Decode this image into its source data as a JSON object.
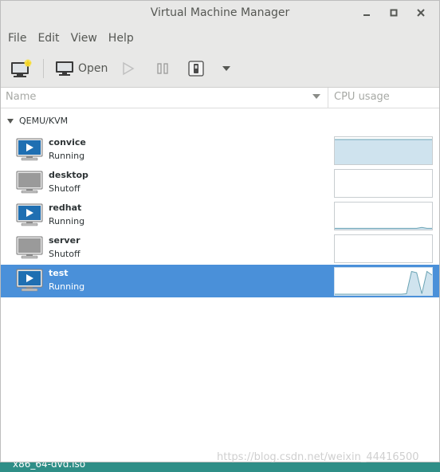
{
  "window": {
    "title": "Virtual Machine Manager",
    "controls": [
      "minimize",
      "maximize",
      "close"
    ]
  },
  "menu": [
    "File",
    "Edit",
    "View",
    "Help"
  ],
  "toolbar": {
    "open_label": "Open"
  },
  "table": {
    "columns": [
      "Name",
      "CPU usage"
    ]
  },
  "group": {
    "label": "QEMU/KVM"
  },
  "vms": [
    {
      "name": "convice",
      "status": "Running",
      "cpu": [
        1,
        1,
        1,
        1,
        1,
        1,
        1,
        1,
        1,
        1,
        1,
        1,
        1,
        1,
        1,
        1,
        1,
        1,
        1,
        1
      ]
    },
    {
      "name": "desktop",
      "status": "Shutoff",
      "cpu": []
    },
    {
      "name": "redhat",
      "status": "Running",
      "cpu": [
        0.02,
        0.02,
        0.02,
        0.02,
        0.02,
        0.02,
        0.02,
        0.02,
        0.02,
        0.02,
        0.02,
        0.02,
        0.02,
        0.02,
        0.02,
        0.02,
        0.02,
        0.06,
        0.02,
        0.02
      ]
    },
    {
      "name": "server",
      "status": "Shutoff",
      "cpu": []
    },
    {
      "name": "test",
      "status": "Running",
      "cpu": [
        0,
        0,
        0,
        0,
        0,
        0,
        0,
        0,
        0,
        0,
        0,
        0,
        0,
        0,
        0.02,
        0.95,
        0.9,
        0.02,
        0.95,
        0.8
      ]
    }
  ],
  "colors": {
    "selection": "#4a90d9",
    "graph_fill": "#cfe3ee",
    "graph_line": "#6aa3b4",
    "running_icon": "#1f6fb2",
    "shutoff_icon": "#9a9a9a"
  },
  "taskbar": {
    "text": "x86_64-dvd.iso"
  },
  "watermark": "https://blog.csdn.net/weixin_44416500"
}
